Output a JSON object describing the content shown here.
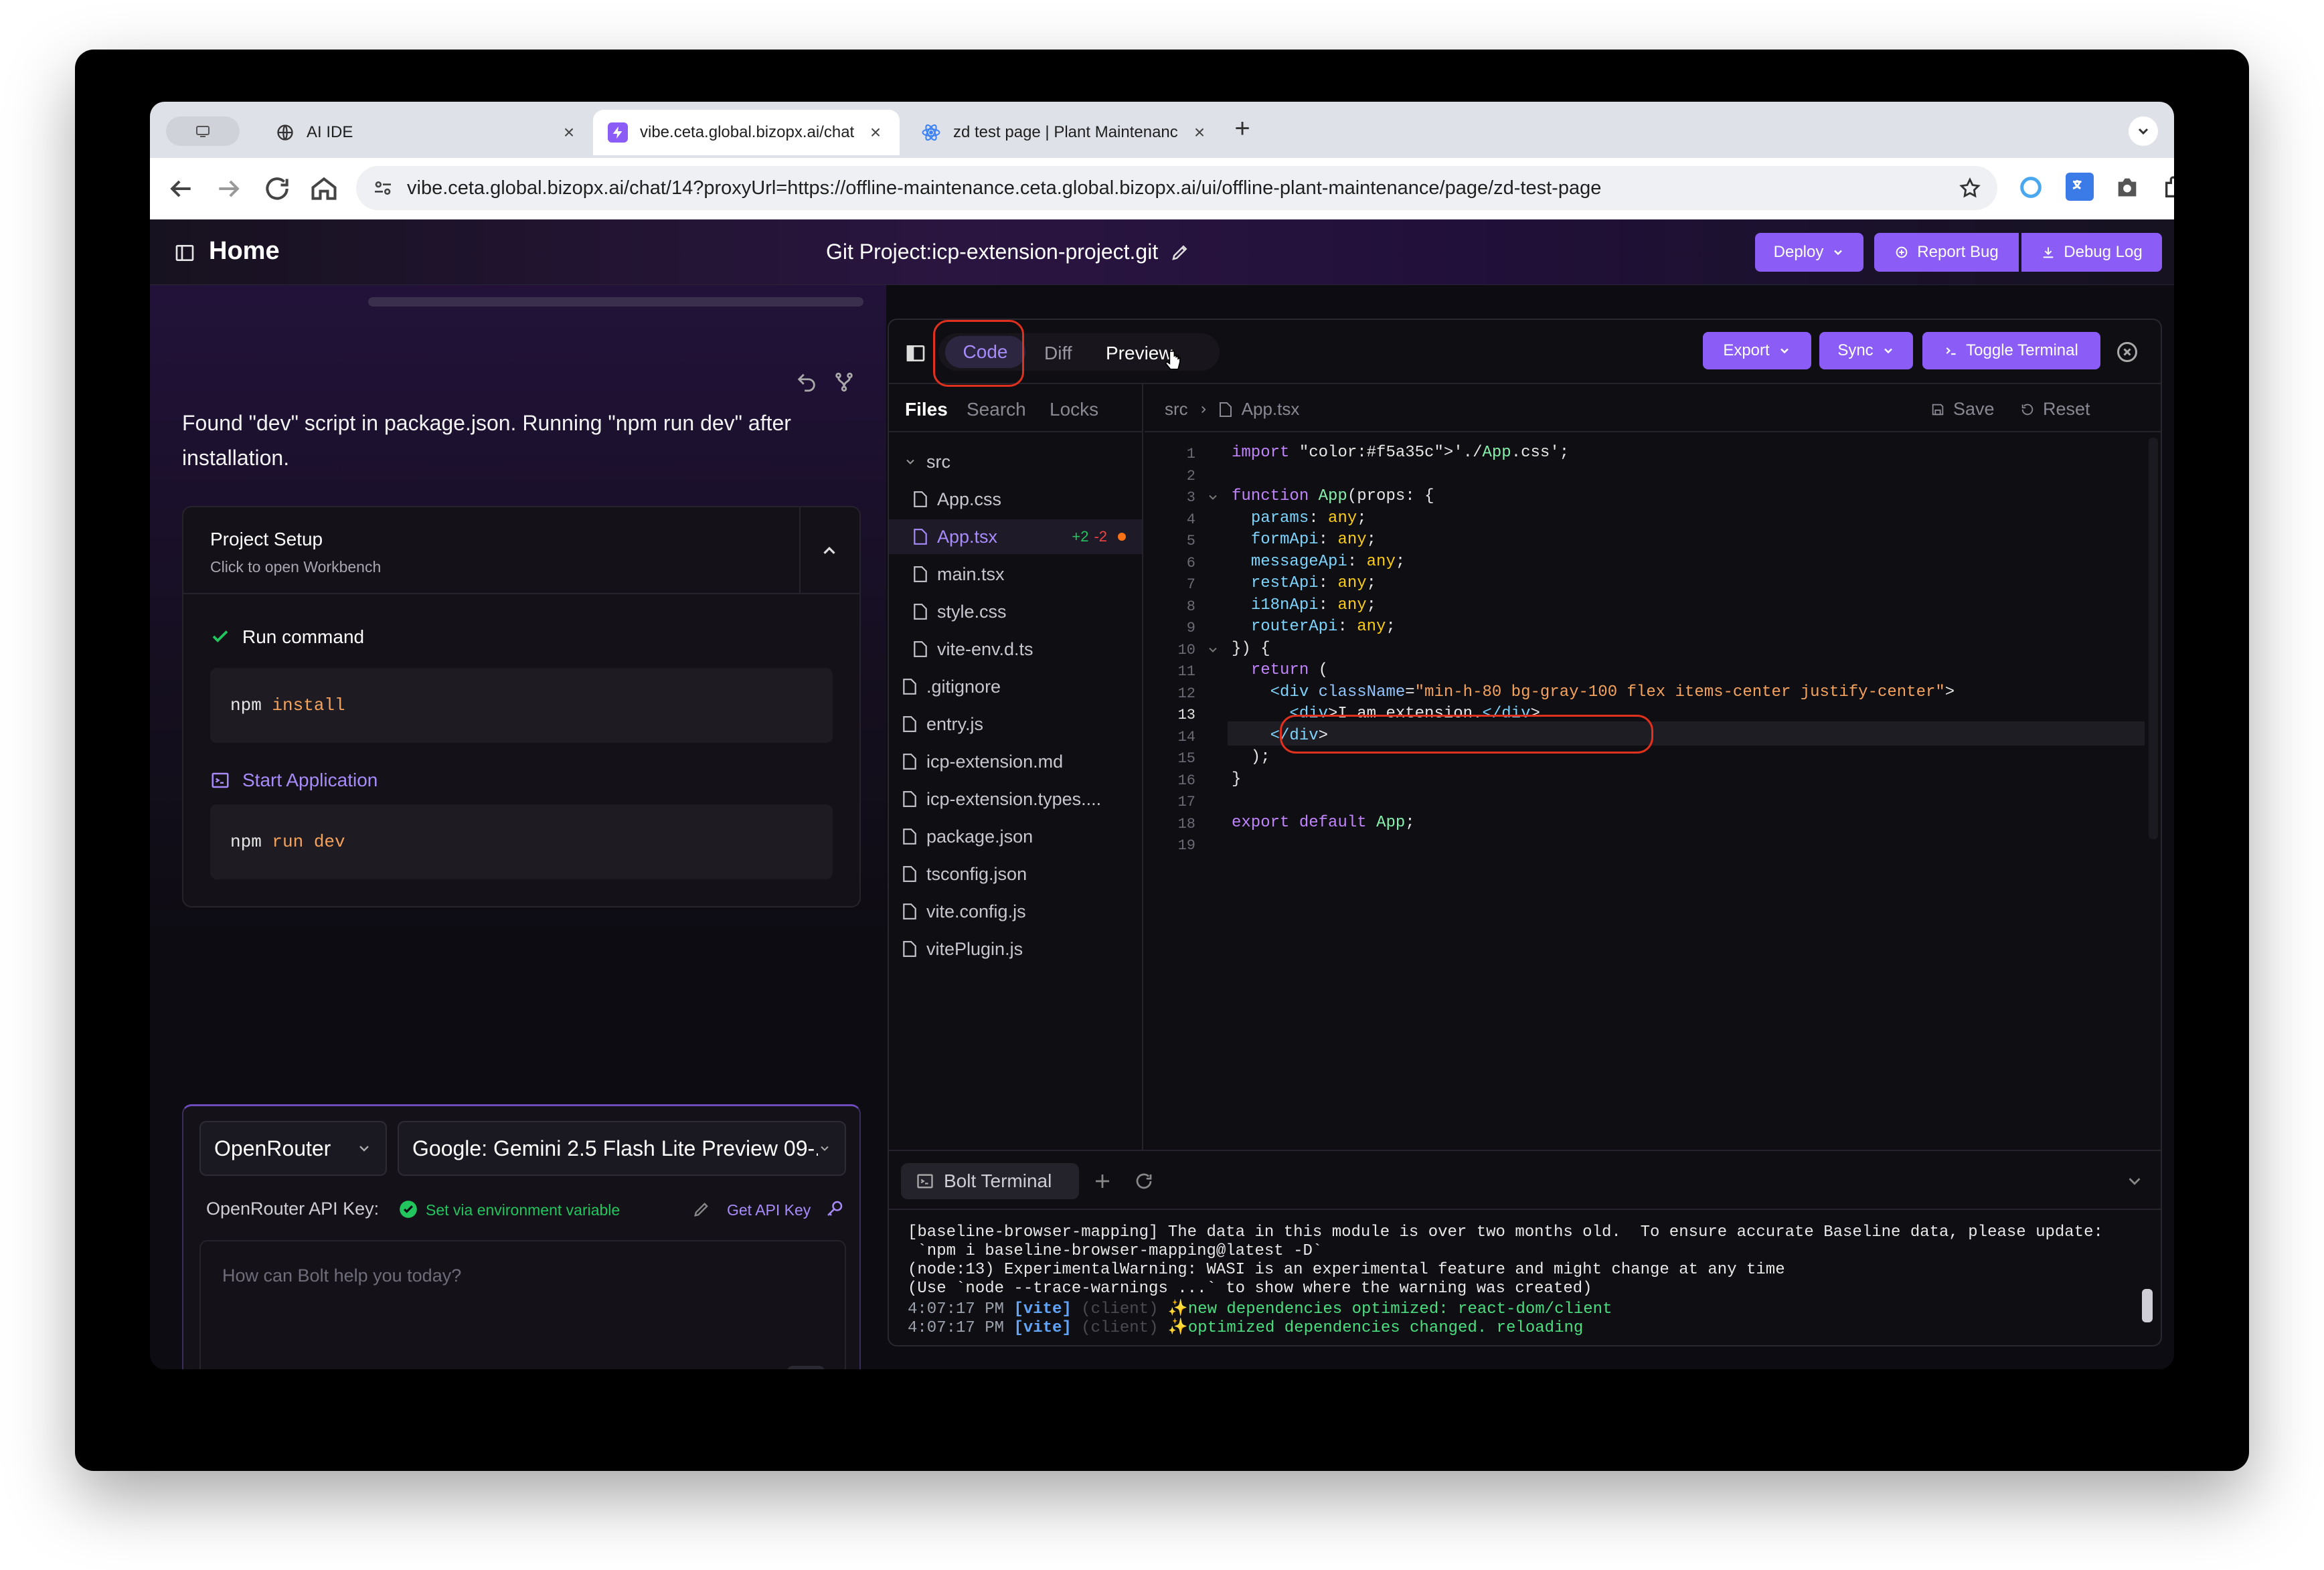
{
  "browser": {
    "tabs": [
      {
        "title": "AI IDE"
      },
      {
        "title": "vibe.ceta.global.bizopx.ai/chat"
      },
      {
        "title": "zd test page | Plant Maintenance"
      }
    ],
    "url": "vibe.ceta.global.bizopx.ai/chat/14?proxyUrl=https://offline-maintenance.ceta.global.bizopx.ai/ui/offline-plant-maintenance/page/zd-test-page",
    "new_tab": "+"
  },
  "header": {
    "home": "Home",
    "project_title": "Git Project:icp-extension-project.git",
    "deploy": "Deploy",
    "report_bug": "Report Bug",
    "debug_log": "Debug Log"
  },
  "chat": {
    "message": "Found \"dev\" script in package.json. Running \"npm run dev\" after installation.",
    "setup": {
      "title": "Project Setup",
      "subtitle": "Click to open Workbench",
      "step1_label": "Run command",
      "step1_cmd": "npm",
      "step1_arg": "install",
      "step2_label": "Start Application",
      "step2_cmd": "npm",
      "step2_arg": "run dev"
    },
    "provider": "OpenRouter",
    "model": "Google: Gemini 2.5 Flash Lite Preview 09-...",
    "api_key_label": "OpenRouter API Key:",
    "api_key_status": "Set via environment variable",
    "get_api_key": "Get API Key",
    "prompt_placeholder": "How can Bolt help you today?"
  },
  "workbench": {
    "tabs": {
      "code": "Code",
      "diff": "Diff",
      "preview": "Preview"
    },
    "export": "Export",
    "sync": "Sync",
    "toggle_terminal": "Toggle Terminal",
    "side_tabs": {
      "files": "Files",
      "search": "Search",
      "locks": "Locks"
    },
    "breadcrumb": {
      "folder": "src",
      "file": "App.tsx"
    },
    "save": "Save",
    "reset": "Reset",
    "tree": {
      "src": "src",
      "src_files": [
        "App.css",
        "App.tsx",
        "main.tsx",
        "style.css",
        "vite-env.d.ts"
      ],
      "app_diff_add": "+2",
      "app_diff_del": "-2",
      "root_files": [
        ".gitignore",
        "entry.js",
        "icp-extension.md",
        "icp-extension.types....",
        "package.json",
        "tsconfig.json",
        "vite.config.js",
        "vitePlugin.js"
      ]
    },
    "code_lines": [
      "import './App.css';",
      "",
      "function App(props: {",
      "  params: any;",
      "  formApi: any;",
      "  messageApi: any;",
      "  restApi: any;",
      "  i18nApi: any;",
      "  routerApi: any;",
      "}) {",
      "  return (",
      "    <div className=\"min-h-80 bg-gray-100 flex items-center justify-center\">",
      "      <div>I am extension.</div>",
      "    </div>",
      "  );",
      "}",
      "",
      "export default App;",
      ""
    ],
    "terminal_title": "Bolt Terminal",
    "terminal_lines": [
      "[baseline-browser-mapping] The data in this module is over two months old.  To ensure accurate Baseline data, please update:",
      " `npm i baseline-browser-mapping@latest -D`",
      "(node:13) ExperimentalWarning: WASI is an experimental feature and might change at any time",
      "(Use `node --trace-warnings ...` to show where the warning was created)"
    ],
    "log1": {
      "time": "4:07:17 PM",
      "tag": "[vite]",
      "ctx": "(client)",
      "msg": "✨new dependencies optimized: react-dom/client"
    },
    "log2": {
      "time": "4:07:17 PM",
      "tag": "[vite]",
      "ctx": "(client)",
      "msg": "✨optimized dependencies changed. reloading"
    }
  },
  "colors": {
    "accent": "#8b5cf6",
    "annotation": "#e0301e",
    "success": "#22c55e"
  }
}
